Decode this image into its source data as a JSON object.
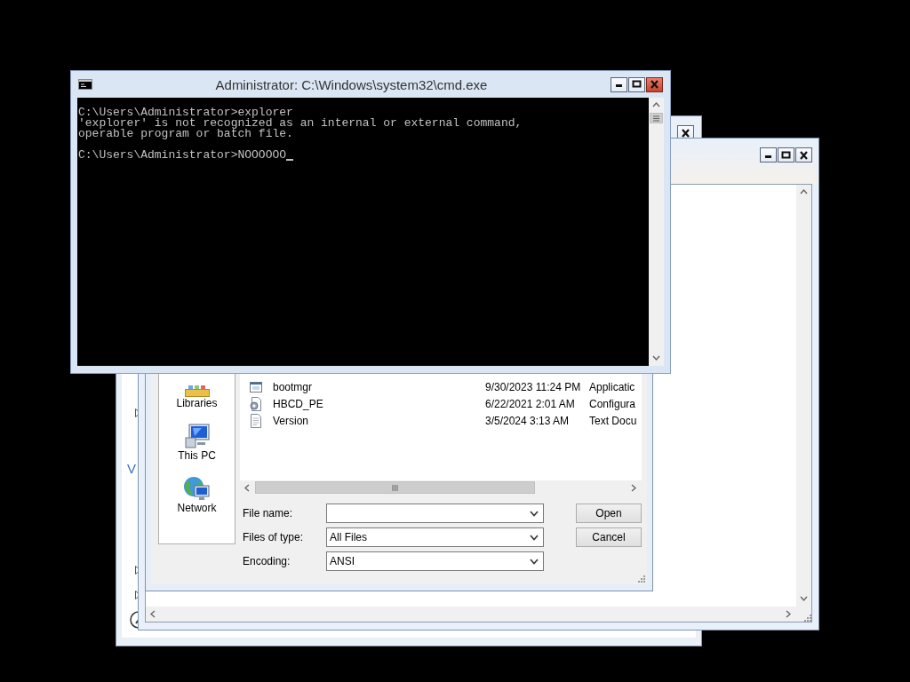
{
  "back_window": {
    "tree_label": "V"
  },
  "open_dialog": {
    "places": [
      {
        "kind": "libraries",
        "label": "Libraries"
      },
      {
        "kind": "computer",
        "label": "This PC"
      },
      {
        "kind": "network",
        "label": "Network"
      }
    ],
    "files": [
      {
        "kind": "application",
        "name": "bootmgr",
        "date_modified": "9/30/2023 11:24 PM",
        "type": "Applicatic"
      },
      {
        "kind": "config",
        "name": "HBCD_PE",
        "date_modified": "6/22/2021 2:01 AM",
        "type": "Configura"
      },
      {
        "kind": "text",
        "name": "Version",
        "date_modified": "3/5/2024 3:13 AM",
        "type": "Text Docu"
      }
    ],
    "file_name": {
      "label": "File name:"
    },
    "file_type": {
      "label": "Files of type:",
      "value": "All Files"
    },
    "encoding": {
      "label": "Encoding:",
      "value": "ANSI"
    },
    "buttons": [
      "Open",
      "Cancel"
    ]
  },
  "cmd_window": {
    "title": "Administrator: C:\\Windows\\system32\\cmd.exe",
    "output_lines": [
      "C:\\Users\\Administrator>explorer",
      "'explorer' is not recognized as an internal or external command,",
      "operable program or batch file."
    ],
    "prompt": "C:\\Users\\Administrator>NOOOOOO"
  }
}
